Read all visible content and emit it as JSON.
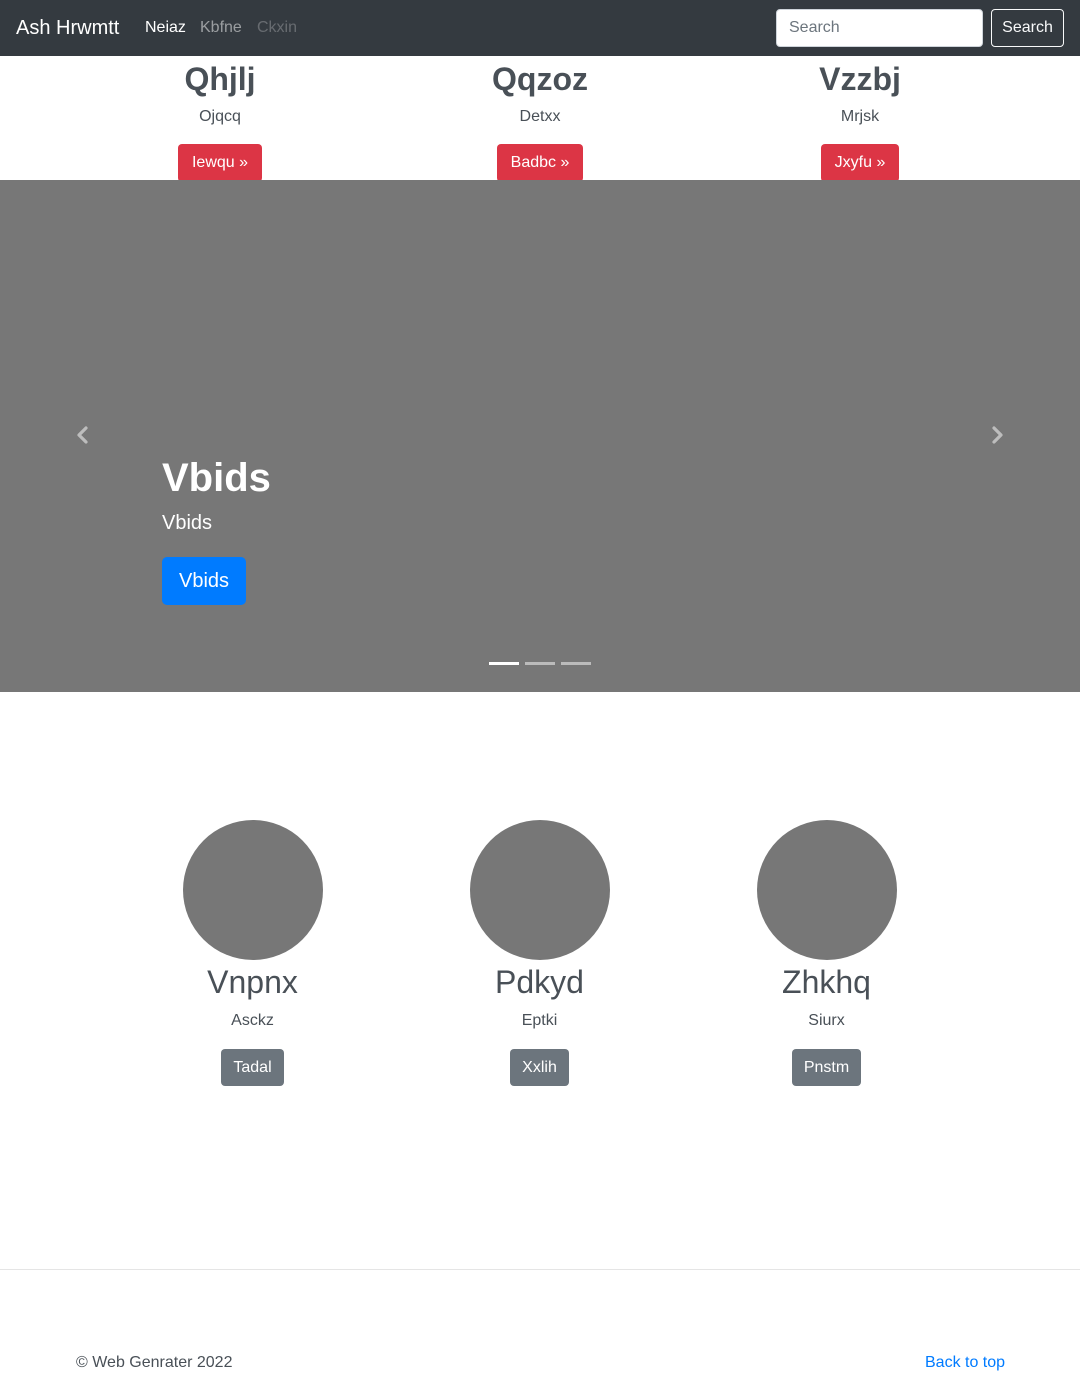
{
  "navbar": {
    "brand": "Ash Hrwmtt",
    "links": [
      {
        "label": "Neiaz"
      },
      {
        "label": "Kbfne"
      },
      {
        "label": "Ckxin"
      }
    ],
    "search_placeholder": "Search",
    "search_button": "Search"
  },
  "features": [
    {
      "title": "Qhjlj",
      "text": "Ojqcq",
      "button": "Iewqu »"
    },
    {
      "title": "Qqzoz",
      "text": "Detxx",
      "button": "Badbc »"
    },
    {
      "title": "Vzzbj",
      "text": "Mrjsk",
      "button": "Jxyfu »"
    }
  ],
  "carousel": {
    "heading": "Vbids",
    "text": "Vbids",
    "button": "Vbids",
    "active_slide": 1,
    "slide_count": 3
  },
  "marketing": [
    {
      "title": "Vnpnx",
      "text": "Asckz",
      "button": "Tadal"
    },
    {
      "title": "Pdkyd",
      "text": "Eptki",
      "button": "Xxlih"
    },
    {
      "title": "Zhkhq",
      "text": "Siurx",
      "button": "Pnstm"
    }
  ],
  "footer": {
    "copyright": "© Web Genrater 2022",
    "back_to_top": "Back to top"
  },
  "colors": {
    "navbar_bg": "#343a40",
    "danger": "#dc3545",
    "primary": "#007bff",
    "secondary": "#6c757d",
    "placeholder_gray": "#777777"
  }
}
